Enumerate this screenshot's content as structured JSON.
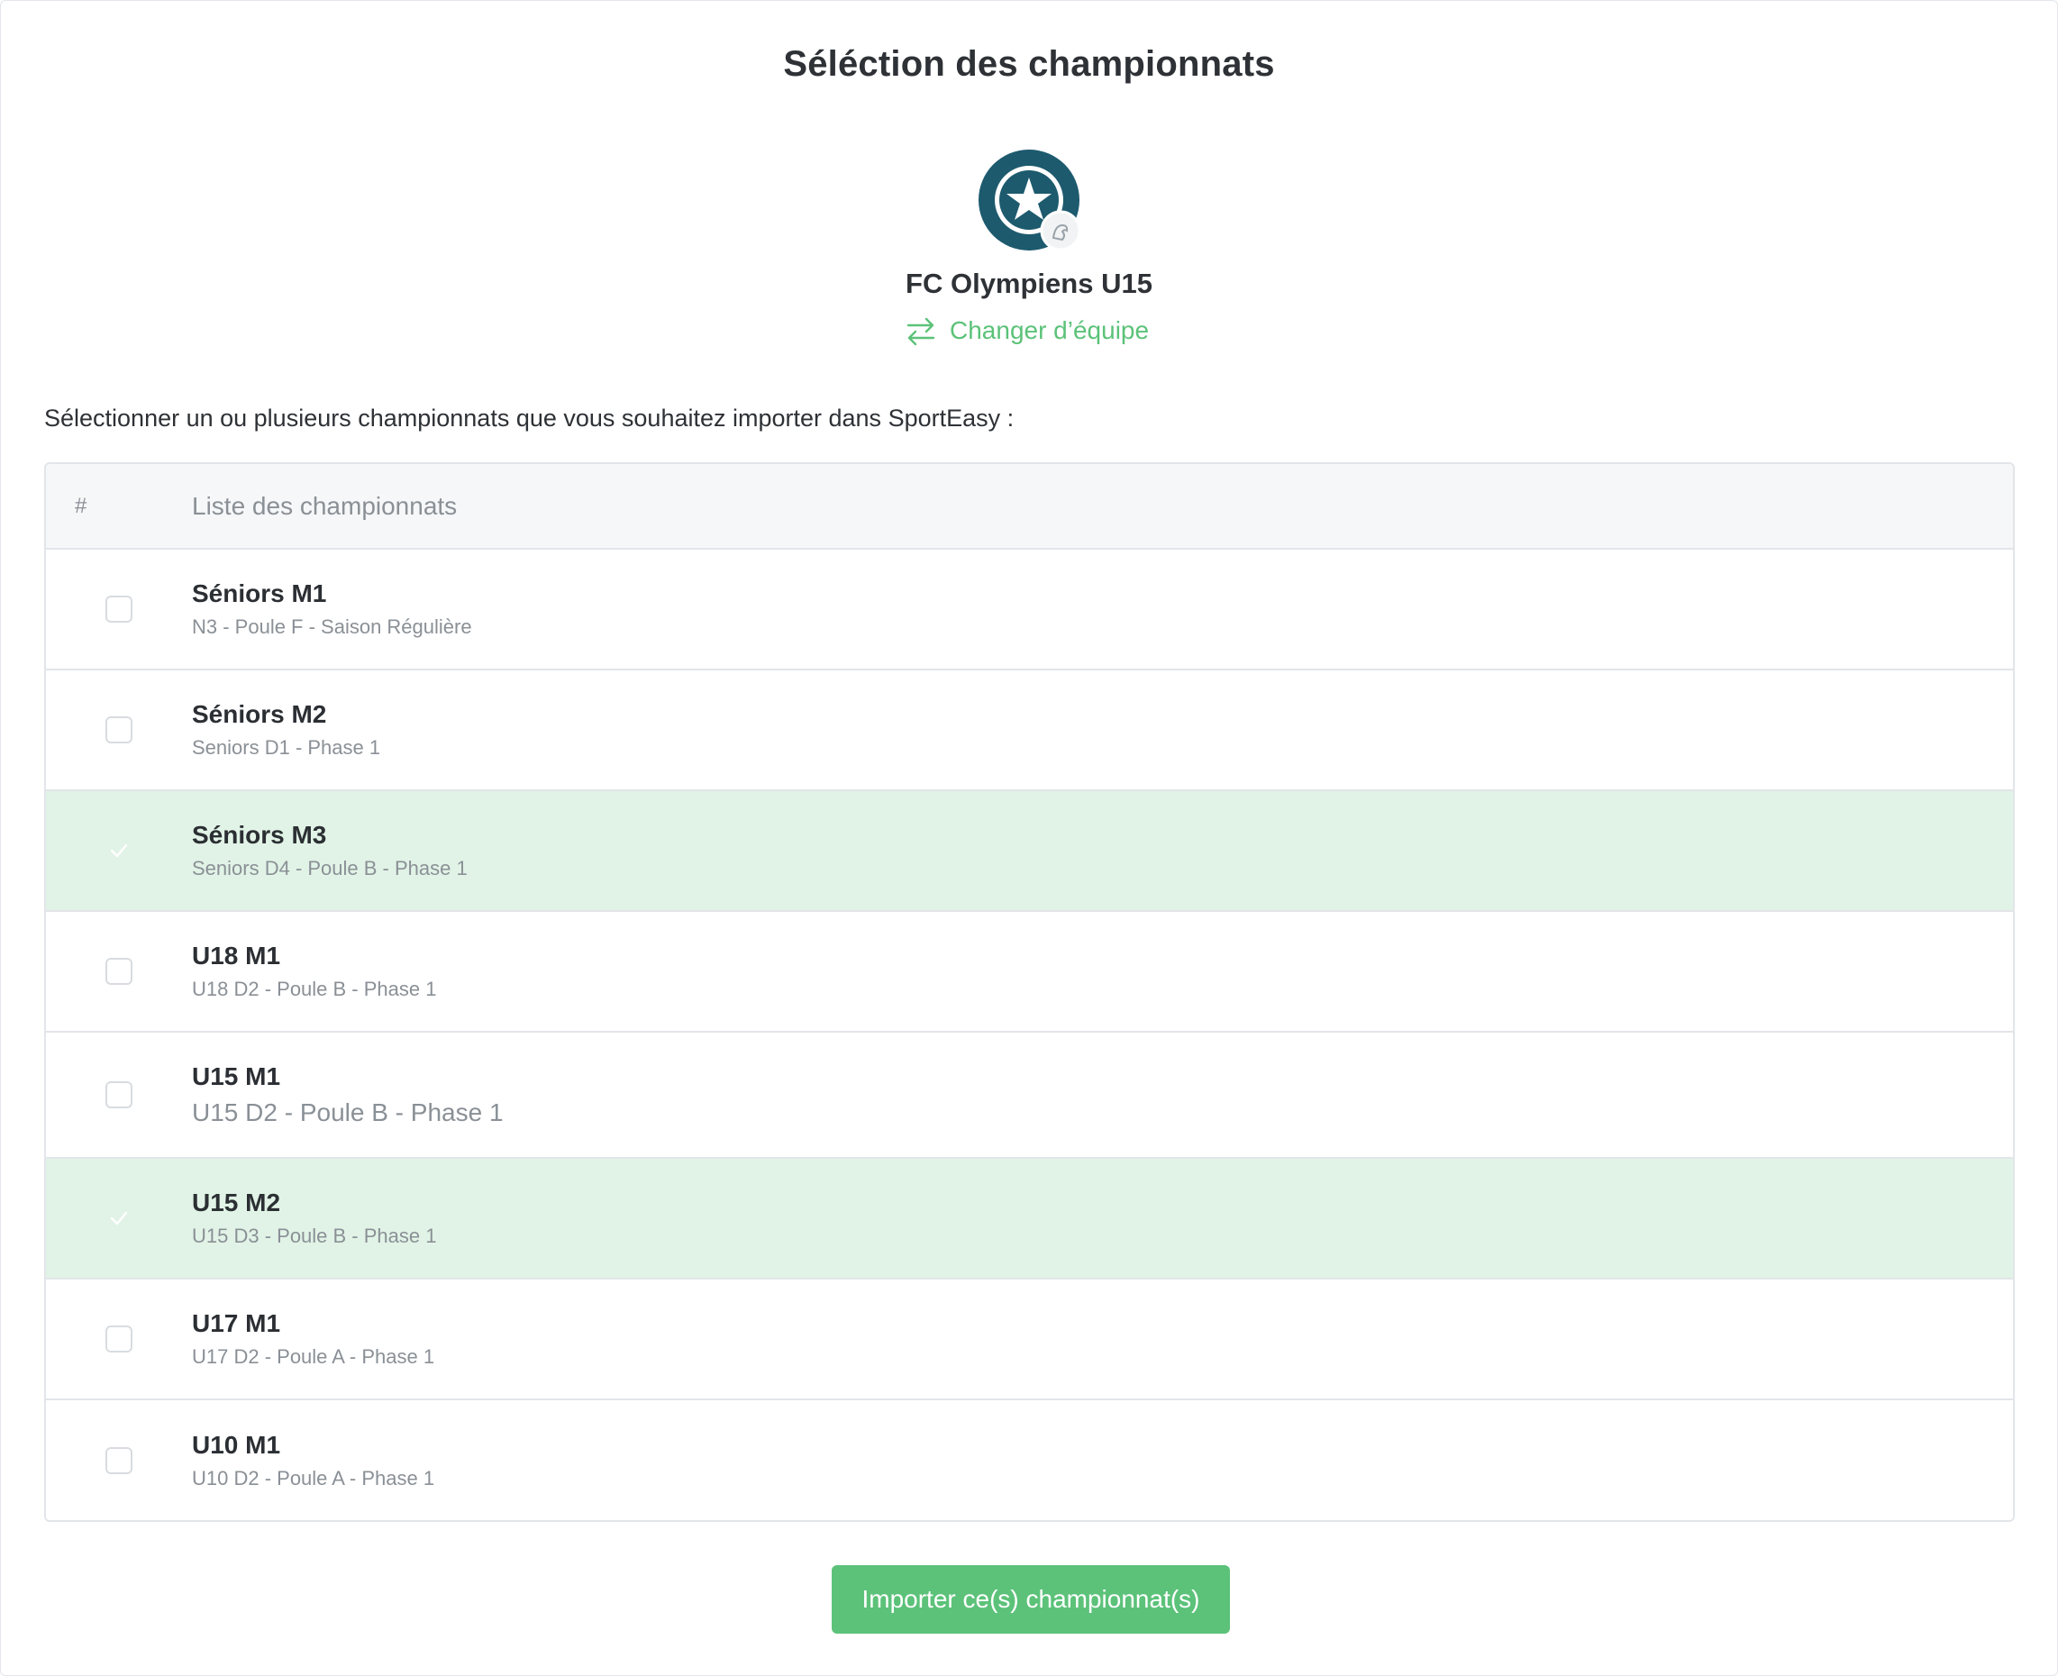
{
  "page": {
    "title": "Séléction des championnats"
  },
  "team": {
    "name": "FC Olympiens U15",
    "change_label": "Changer d’équipe",
    "logo_icon": "team-crest-icon",
    "change_icon": "swap-arrows-icon"
  },
  "instructions": "Sélectionner un ou plusieurs championnats que vous souhaitez importer dans SportEasy :",
  "table": {
    "headers": {
      "index": "#",
      "list": "Liste des championnats"
    },
    "rows": [
      {
        "name": "Séniors M1",
        "subtitle": "N3 - Poule F - Saison Régulière",
        "selected": false
      },
      {
        "name": "Séniors M2",
        "subtitle": "Seniors D1 - Phase 1",
        "selected": false
      },
      {
        "name": "Séniors M3",
        "subtitle": "Seniors D4 - Poule B - Phase 1",
        "selected": true
      },
      {
        "name": "U18 M1",
        "subtitle": "U18 D2 - Poule B - Phase 1",
        "selected": false
      },
      {
        "name": "U15 M1",
        "subtitle": "U15 D2 - Poule B - Phase 1",
        "selected": false
      },
      {
        "name": "U15 M2",
        "subtitle": "U15 D3 - Poule B - Phase 1",
        "selected": true
      },
      {
        "name": "U17 M1",
        "subtitle": "U17 D2 - Poule A - Phase 1",
        "selected": false
      },
      {
        "name": "U10 M1",
        "subtitle": "U10 D2 - Poule A - Phase 1",
        "selected": false
      }
    ]
  },
  "actions": {
    "import_label": "Importer ce(s) championnat(s)"
  },
  "colors": {
    "accent": "#5cc279",
    "selected_row": "#e1f3e6",
    "crest": "#1d5a6e"
  }
}
